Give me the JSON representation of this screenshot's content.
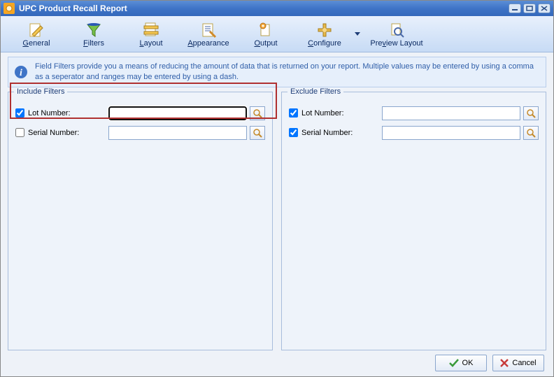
{
  "window": {
    "title": "UPC Product Recall Report"
  },
  "toolbar": {
    "general": "General",
    "filters": "Filters",
    "layout": "Layout",
    "appearance": "Appearance",
    "output": "Output",
    "configure": "Configure",
    "preview": "Preview Layout"
  },
  "info": {
    "text": "Field Filters provide you a means of reducing the amount of data that is returned on your report.  Multiple values may be entered by using a comma as a seperator and ranges may be entered by using a dash."
  },
  "include": {
    "legend": "Include Filters",
    "lot": {
      "label": "Lot Number:",
      "checked": true,
      "value": ""
    },
    "serial": {
      "label": "Serial Number:",
      "checked": false,
      "value": ""
    }
  },
  "exclude": {
    "legend": "Exclude Filters",
    "lot": {
      "label": "Lot Number:",
      "checked": true,
      "value": ""
    },
    "serial": {
      "label": "Serial Number:",
      "checked": true,
      "value": ""
    }
  },
  "buttons": {
    "ok": "OK",
    "cancel": "Cancel"
  }
}
